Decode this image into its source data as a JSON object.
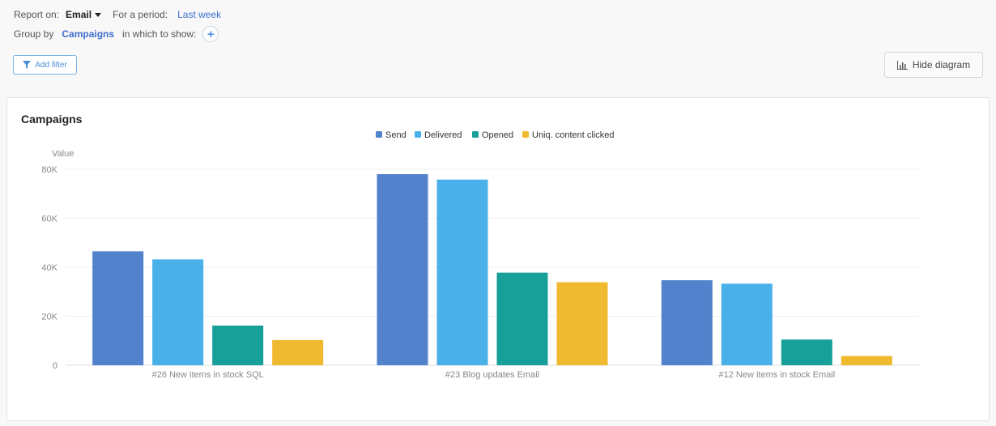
{
  "filters": {
    "report_on_label": "Report on:",
    "report_on_value": "Email",
    "period_label": "For a period:",
    "period_value": "Last week",
    "group_by_label": "Group by",
    "group_by_value": "Campaigns",
    "show_label": "in which to show:",
    "add_symbol": "+",
    "add_filter_label": "Add filter",
    "hide_diagram_label": "Hide diagram"
  },
  "icons": {
    "caret": "caret-down-icon",
    "add": "plus-icon",
    "filter": "filter-icon",
    "diagram": "bar-chart-icon"
  },
  "colors": {
    "accent": "#3f6fcb",
    "send": "#5282cc",
    "delivered": "#49b0ea",
    "opened": "#17a09a",
    "clicked": "#f0ba30"
  },
  "chart_data": {
    "type": "bar",
    "title": "Campaigns",
    "ylabel": "Value",
    "xlabel": "",
    "ylim": [
      0,
      80000
    ],
    "yticks": [
      0,
      20000,
      40000,
      60000,
      80000
    ],
    "ytick_labels": [
      "0",
      "20K",
      "40K",
      "60K",
      "80K"
    ],
    "grid": true,
    "legend_position": "top-center",
    "categories": [
      "#26 New items in stock SQL",
      "#23 Blog updates Email",
      "#12 New items in stock Email"
    ],
    "series": [
      {
        "name": "Send",
        "color": "#5282cc",
        "values": [
          46500,
          78000,
          34700
        ]
      },
      {
        "name": "Delivered",
        "color": "#49b0ea",
        "values": [
          43200,
          75800,
          33300
        ]
      },
      {
        "name": "Opened",
        "color": "#17a09a",
        "values": [
          16200,
          37800,
          10500
        ]
      },
      {
        "name": "Uniq. content clicked",
        "color": "#f0ba30",
        "values": [
          10300,
          33900,
          3800
        ]
      }
    ]
  }
}
